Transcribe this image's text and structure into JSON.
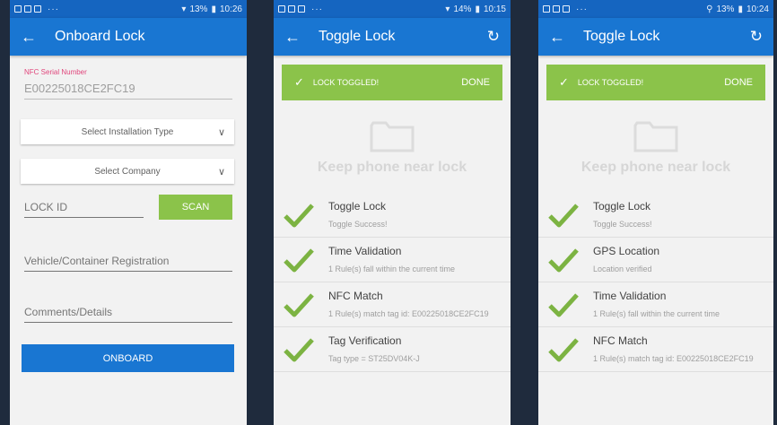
{
  "status": {
    "p1": {
      "battery": "13%",
      "time": "10:26"
    },
    "p2": {
      "battery": "14%",
      "time": "10:15"
    },
    "p3": {
      "battery": "13%",
      "time": "10:24"
    }
  },
  "onboard": {
    "title": "Onboard Lock",
    "nfc_label": "NFC Serial Number",
    "nfc_value": "E00225018CE2FC19",
    "installation_placeholder": "Select Installation Type",
    "company_placeholder": "Select Company",
    "lock_id_placeholder": "LOCK ID",
    "scan_label": "SCAN",
    "vehicle_placeholder": "Vehicle/Container Registration",
    "comments_placeholder": "Comments/Details",
    "onboard_label": "ONBOARD"
  },
  "toggle": {
    "title": "Toggle Lock",
    "banner_text": "LOCK TOGGLED!",
    "done_label": "DONE",
    "keep_text": "Keep phone near lock",
    "icons": {
      "back": "arrow-left-icon",
      "refresh": "refresh-icon",
      "folder": "folder-icon",
      "check": "check-icon"
    }
  },
  "steps_p2": [
    {
      "title": "Toggle Lock",
      "detail": "Toggle Success!"
    },
    {
      "title": "Time Validation",
      "detail": "1 Rule(s) fall within the current time"
    },
    {
      "title": "NFC Match",
      "detail": "1 Rule(s) match tag id: E00225018CE2FC19"
    },
    {
      "title": "Tag Verification",
      "detail": "Tag type = ST25DV04K-J"
    }
  ],
  "steps_p3": [
    {
      "title": "Toggle Lock",
      "detail": "Toggle Success!"
    },
    {
      "title": "GPS Location",
      "detail": "Location verified"
    },
    {
      "title": "Time Validation",
      "detail": "1 Rule(s) fall within the current time"
    },
    {
      "title": "NFC Match",
      "detail": "1 Rule(s) match tag id: E00225018CE2FC19"
    }
  ],
  "colors": {
    "appbar": "#1976d2",
    "statusbar": "#1565c0",
    "accent_green": "#8bc34a",
    "check_green": "#7cb342"
  }
}
